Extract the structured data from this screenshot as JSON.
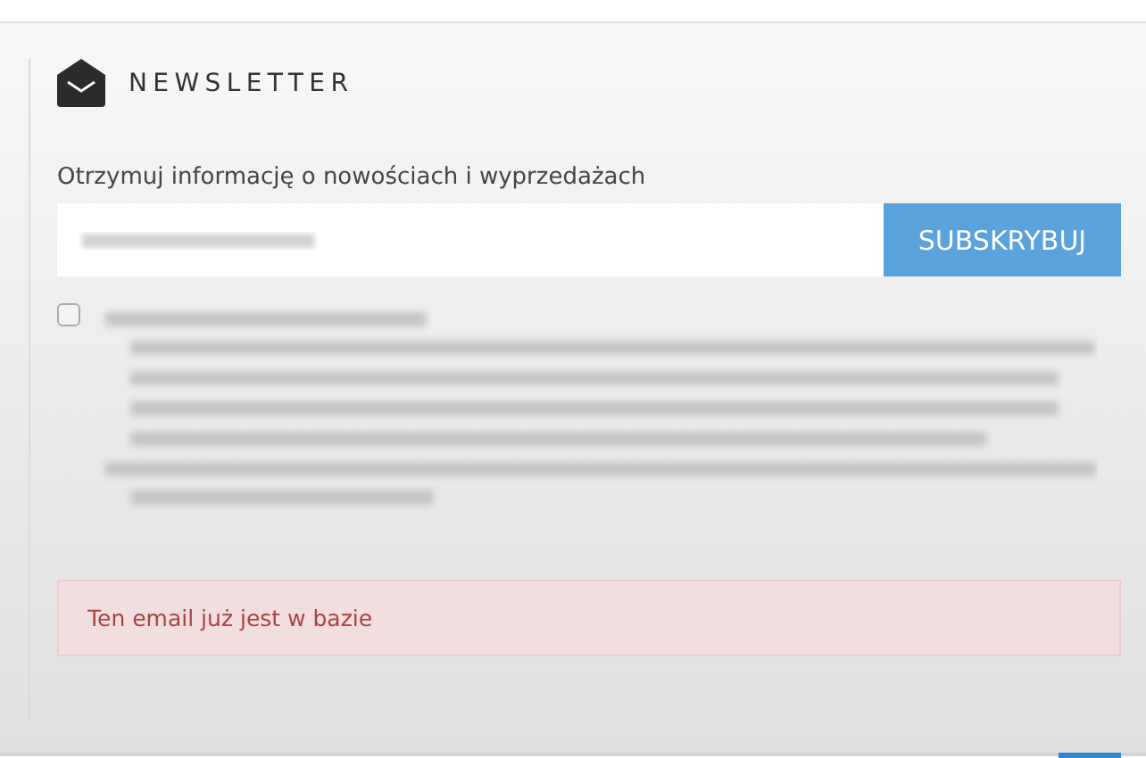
{
  "newsletter": {
    "title": "NEWSLETTER",
    "prompt": "Otrzymuj informację o nowościach i wyprzedażach",
    "email_field": {
      "kind": "blurred"
    },
    "subscribe_button": "SUBSKRYBUJ",
    "consent": {
      "checked": false
    },
    "alert": "Ten email już jest w bazie"
  }
}
